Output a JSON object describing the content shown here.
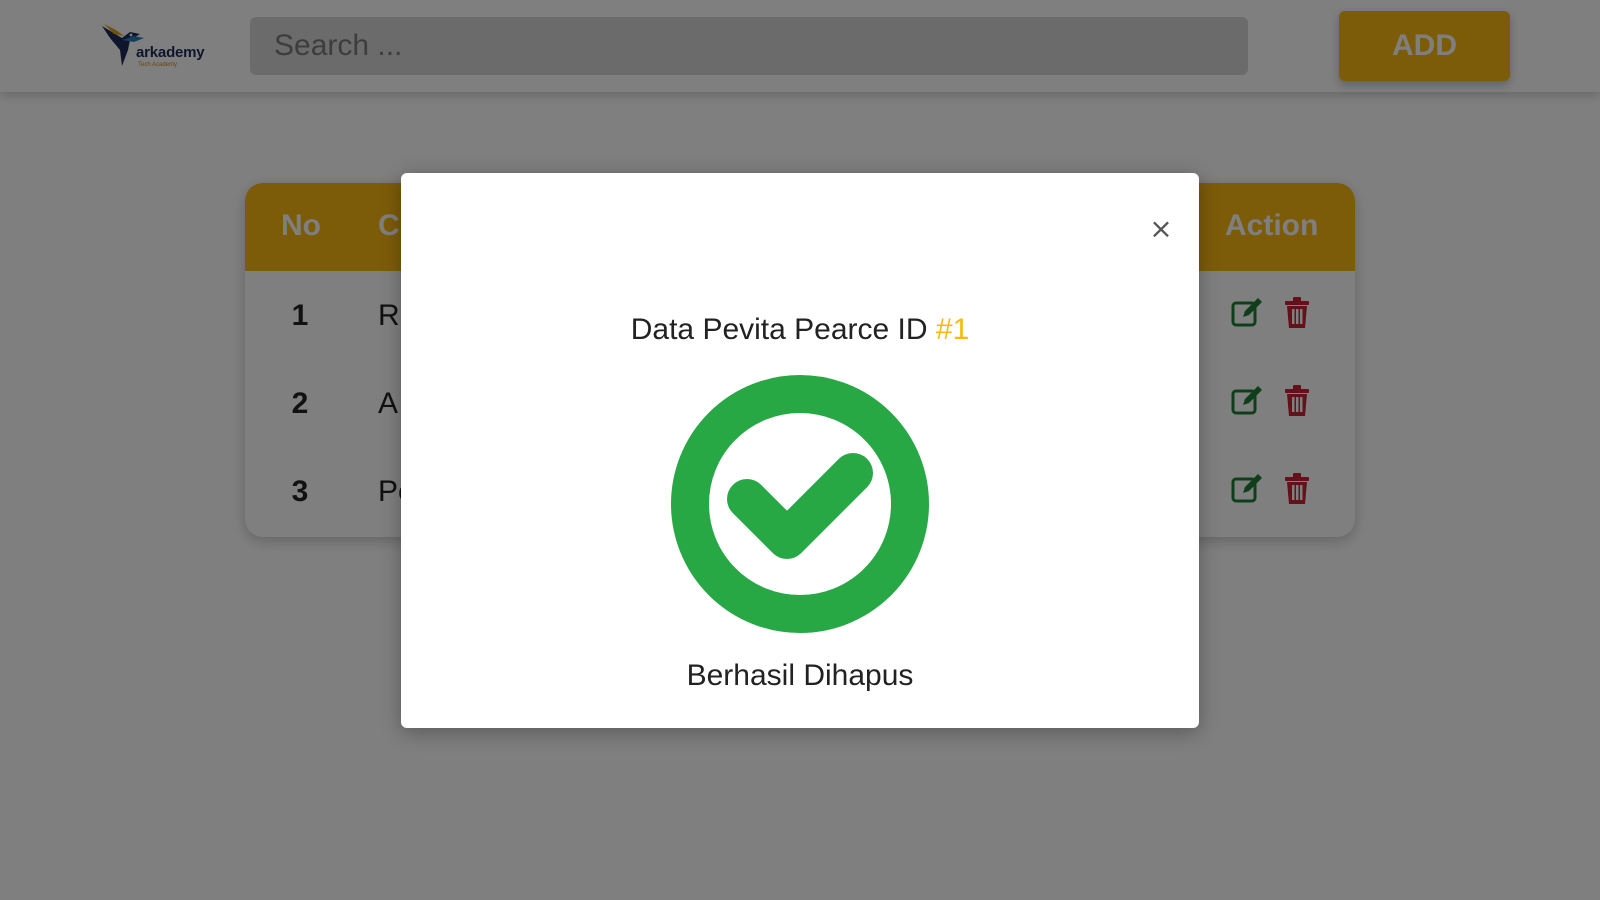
{
  "header": {
    "logo": {
      "text": "arkademy",
      "subtext": "Tech Academy"
    },
    "search": {
      "placeholder": "Search ..."
    },
    "add_label": "ADD"
  },
  "table": {
    "columns": [
      "No",
      "C",
      "Action"
    ],
    "rows": [
      {
        "no": "1",
        "name": "Ra"
      },
      {
        "no": "2",
        "name": "A"
      },
      {
        "no": "3",
        "name": "Pe"
      }
    ]
  },
  "modal": {
    "close_symbol": "×",
    "title_prefix": "Data Pevita Pearce ID ",
    "title_id": "#1",
    "message": "Berhasil Dihapus"
  },
  "colors": {
    "accent": "#fbb812",
    "success": "#28a745",
    "edit": "#1e7e34",
    "delete": "#c82333",
    "overlay": "rgba(0,0,0,0.5)"
  },
  "icons": {
    "edit": "edit-icon",
    "delete": "trash-icon",
    "success": "check-circle-icon",
    "close": "close-icon"
  }
}
